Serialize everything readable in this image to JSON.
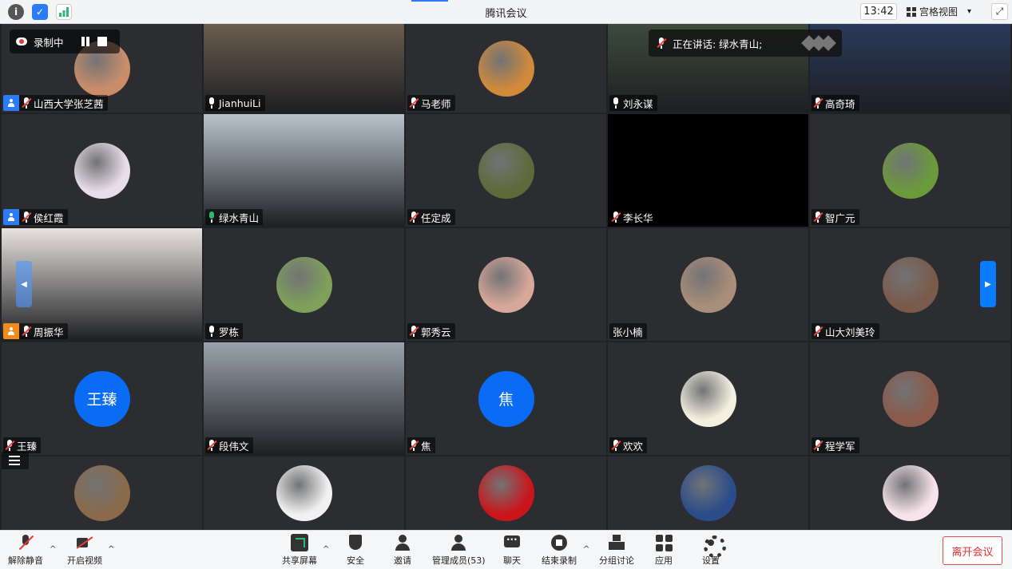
{
  "window": {
    "title": "腾讯会议",
    "time": "13:42",
    "view_label": "宫格视图",
    "view_caret": "▾",
    "fullscreen_icon": "⤢"
  },
  "recording": {
    "label": "录制中"
  },
  "speaking": {
    "label": "正在讲话: 绿水青山;"
  },
  "tiles": [
    {
      "name": "山西大学张芝茜",
      "host": true,
      "mic": "muted",
      "kind": "avatar",
      "color": "#c98d6a"
    },
    {
      "name": "JianhuiLi",
      "host": false,
      "mic": "on",
      "kind": "video",
      "color": "#6b5d4f"
    },
    {
      "name": "马老师",
      "host": false,
      "mic": "muted",
      "kind": "avatar",
      "color": "#d08a3a"
    },
    {
      "name": "刘永谋",
      "host": false,
      "mic": "on",
      "kind": "video",
      "color": "#3c4a3c"
    },
    {
      "name": "高奇琦",
      "host": false,
      "mic": "muted",
      "kind": "video",
      "color": "#2a3a5a"
    },
    {
      "name": "侯红霞",
      "host": true,
      "mic": "muted",
      "kind": "avatar",
      "color": "#e8dde8"
    },
    {
      "name": "绿水青山",
      "host": false,
      "mic": "active",
      "kind": "video",
      "color": "#b9c3cc"
    },
    {
      "name": "任定成",
      "host": false,
      "mic": "muted",
      "kind": "avatar",
      "color": "#5f6a3a"
    },
    {
      "name": "李长华",
      "host": false,
      "mic": "muted",
      "kind": "black",
      "color": "#000000"
    },
    {
      "name": "智广元",
      "host": false,
      "mic": "muted",
      "kind": "avatar",
      "color": "#6b9a3a"
    },
    {
      "name": "周振华",
      "host": true,
      "host_color": "orange",
      "mic": "muted",
      "kind": "video",
      "color": "#e9e3df"
    },
    {
      "name": "罗栋",
      "host": false,
      "mic": "on",
      "kind": "avatar",
      "color": "#7ea05a"
    },
    {
      "name": "郭秀云",
      "host": false,
      "mic": "muted",
      "kind": "avatar",
      "color": "#d7a89a"
    },
    {
      "name": "张小楠",
      "host": false,
      "mic": "none",
      "kind": "avatar",
      "color": "#a98e7a"
    },
    {
      "name": "山大刘美玲",
      "host": false,
      "mic": "muted",
      "kind": "avatar",
      "color": "#7a5a4a"
    },
    {
      "name": "王臻",
      "host": false,
      "mic": "muted",
      "kind": "text",
      "avatar_text": "王臻",
      "color": "#0a6cf5"
    },
    {
      "name": "段伟文",
      "host": false,
      "mic": "muted",
      "kind": "video",
      "color": "#9aa3ad"
    },
    {
      "name": "焦",
      "host": false,
      "mic": "muted",
      "kind": "text",
      "avatar_text": "焦",
      "color": "#0a6cf5"
    },
    {
      "name": "欢欢",
      "host": false,
      "mic": "muted",
      "kind": "avatar",
      "color": "#f3f0e0"
    },
    {
      "name": "程学军",
      "host": false,
      "mic": "muted",
      "kind": "avatar",
      "color": "#8a5a4a"
    },
    {
      "name": "",
      "host": false,
      "mic": "none",
      "kind": "avatar",
      "color": "#8a6a4a"
    },
    {
      "name": "",
      "host": false,
      "mic": "none",
      "kind": "avatar",
      "color": "#f1f1f1"
    },
    {
      "name": "",
      "host": false,
      "mic": "none",
      "kind": "avatar",
      "color": "#c9161b"
    },
    {
      "name": "",
      "host": false,
      "mic": "none",
      "kind": "avatar",
      "color": "#2a4c8a"
    },
    {
      "name": "",
      "host": false,
      "mic": "none",
      "kind": "avatar",
      "color": "#f7e3ea"
    }
  ],
  "toolbar": {
    "unmute": "解除静音",
    "start_video": "开启视频",
    "share_screen": "共享屏幕",
    "security": "安全",
    "invite": "邀请",
    "manage_members": "管理成员(53)",
    "chat": "聊天",
    "end_recording": "结束录制",
    "breakout": "分组讨论",
    "apps": "应用",
    "settings": "设置",
    "leave": "离开会议",
    "caret": "^"
  }
}
